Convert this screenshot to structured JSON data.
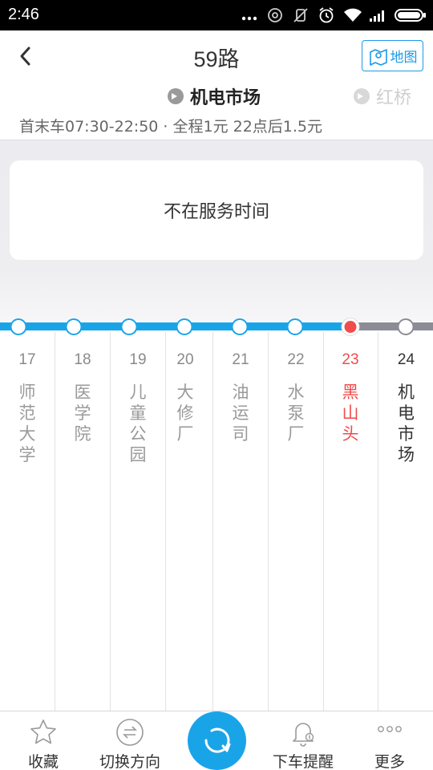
{
  "status_bar": {
    "time": "2:46",
    "icons": [
      "more-dots-icon",
      "alarm-icon",
      "mute-icon",
      "clock-icon",
      "wifi-icon",
      "signal-icon",
      "battery-icon"
    ]
  },
  "header": {
    "title": "59路",
    "map_label": "地图",
    "direction_active": "机电市场",
    "direction_other": "红桥",
    "info": "首末车07:30-22:50 · 全程1元 22点后1.5元"
  },
  "notice": "不在服务时间",
  "colors": {
    "accent": "#1aa4e8",
    "current_stop": "#f24b4b",
    "inactive_line": "#8c8c96"
  },
  "stops": [
    {
      "num": "17",
      "name": "师范大学"
    },
    {
      "num": "18",
      "name": "医学院"
    },
    {
      "num": "19",
      "name": "儿童公园"
    },
    {
      "num": "20",
      "name": "大修厂"
    },
    {
      "num": "21",
      "name": "油运司"
    },
    {
      "num": "22",
      "name": "水泵厂"
    },
    {
      "num": "23",
      "name": "黑山头"
    },
    {
      "num": "24",
      "name": "机电市场"
    }
  ],
  "bottom_bar": {
    "favorite": "收藏",
    "switch_direction": "切换方向",
    "refresh_icon": "refresh-icon",
    "alight_reminder": "下车提醒",
    "more": "更多"
  }
}
